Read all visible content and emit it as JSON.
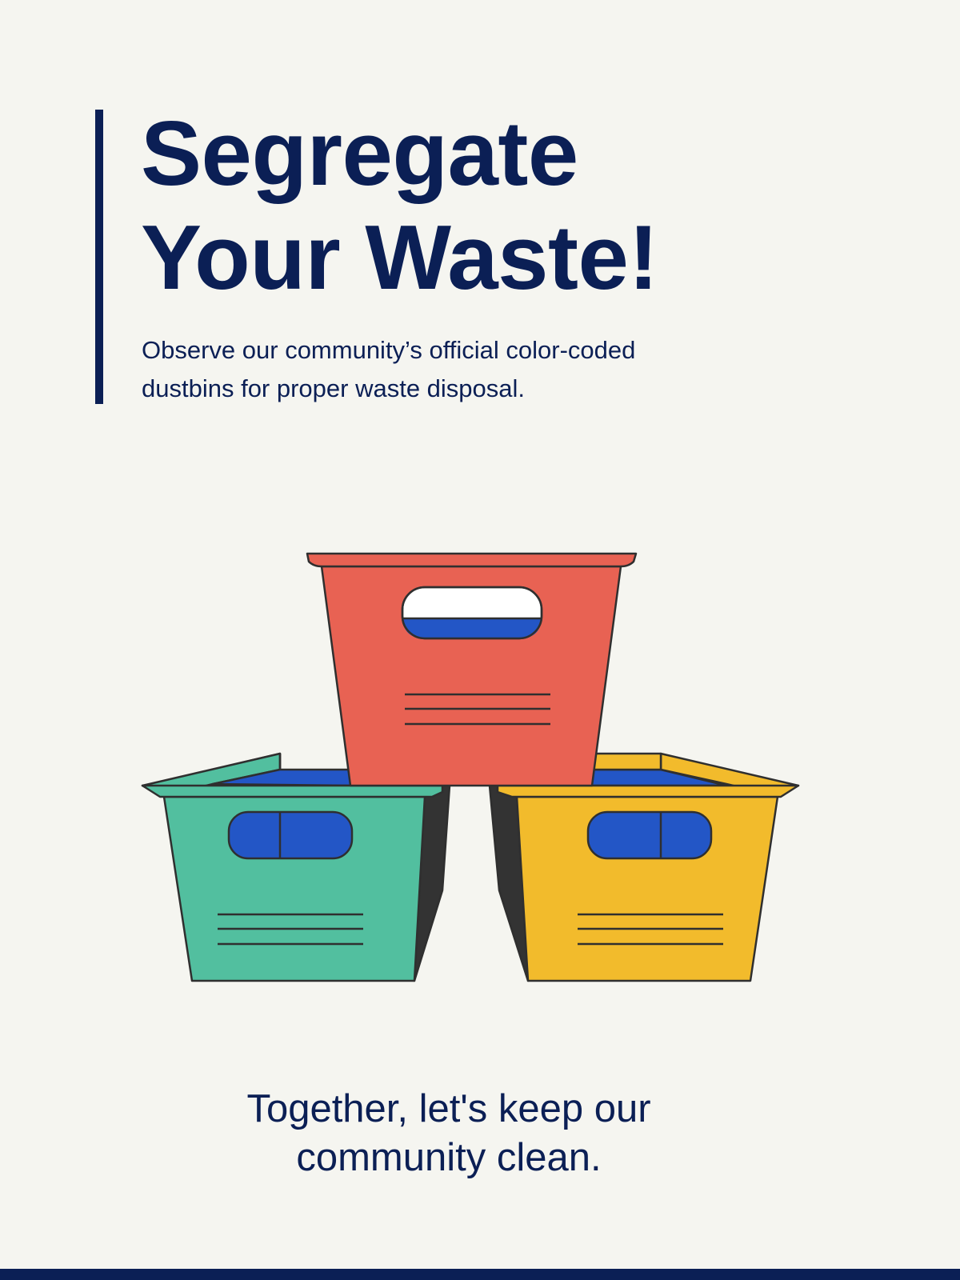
{
  "poster": {
    "headline": {
      "line1": "Segregate",
      "line2": "Your Waste!"
    },
    "subtext": {
      "line1": "Observe our community’s official color-coded",
      "line2": "dustbins for proper waste disposal."
    },
    "tagline": {
      "line1": "Together, let's keep our",
      "line2": "community clean."
    }
  },
  "illustration": {
    "icon": "stacked-dustbins-illustration",
    "bins": [
      {
        "name": "red-bin",
        "color": "#e86253"
      },
      {
        "name": "green-bin",
        "color": "#52bf9f"
      },
      {
        "name": "yellow-bin",
        "color": "#f2bb2c"
      }
    ],
    "handle_color": "#2356c6",
    "outline_color": "#2f2f2f"
  },
  "colors": {
    "background": "#f5f5f0",
    "navy": "#0b1f55"
  }
}
